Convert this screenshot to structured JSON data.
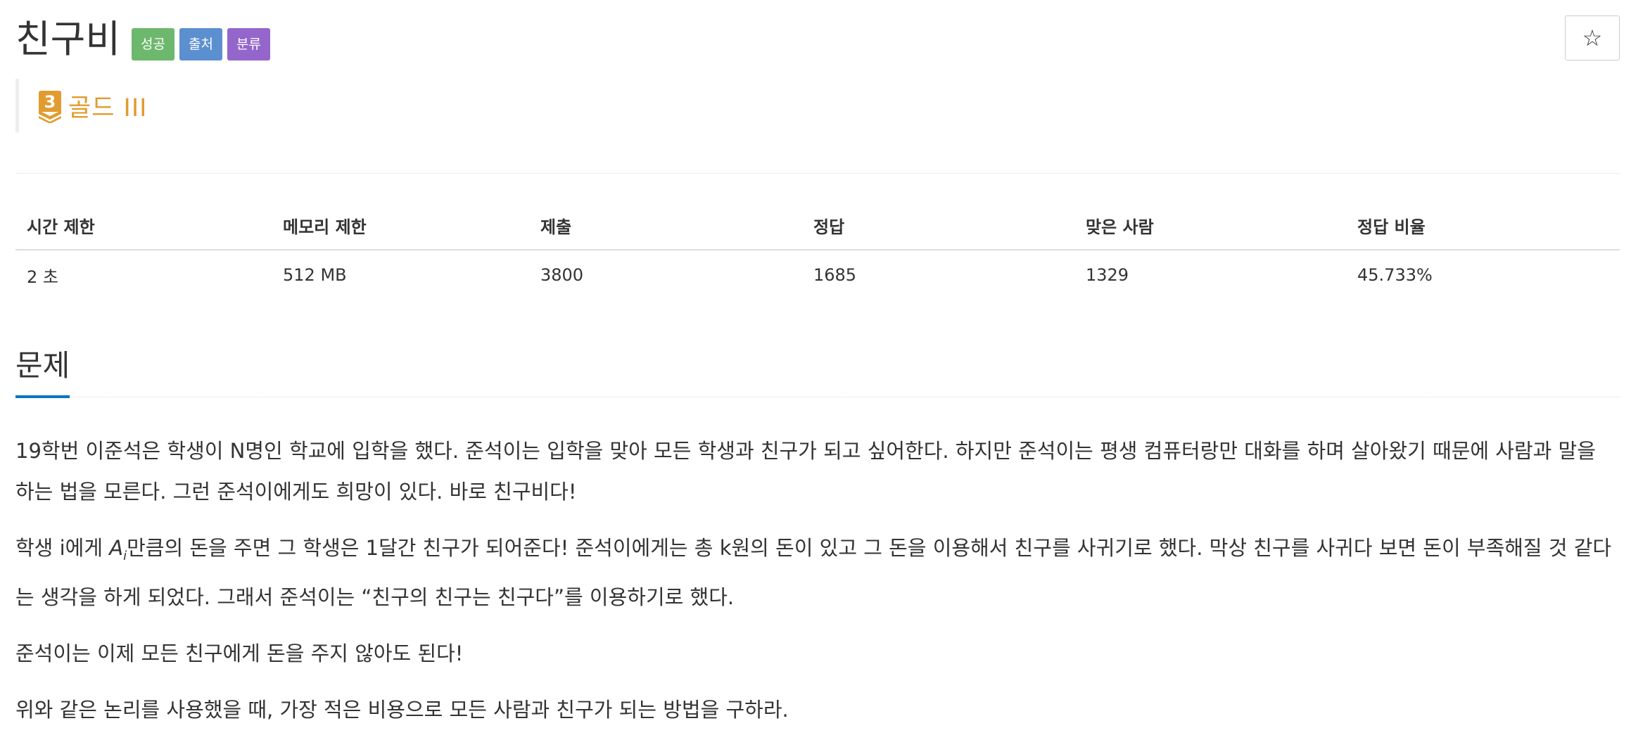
{
  "header": {
    "title": "친구비",
    "labels": {
      "success": "성공",
      "source": "출처",
      "category": "분류"
    },
    "star_icon": "☆",
    "tier": {
      "number": "3",
      "text": "골드 III",
      "color": "#e19b2f"
    }
  },
  "stats": {
    "headers": [
      "시간 제한",
      "메모리 제한",
      "제출",
      "정답",
      "맞은 사람",
      "정답 비율"
    ],
    "values": [
      "2 초",
      "512 MB",
      "3800",
      "1685",
      "1329",
      "45.733%"
    ]
  },
  "problem": {
    "section_title": "문제",
    "paragraph1": "19학번 이준석은 학생이 N명인 학교에 입학을 했다. 준석이는 입학을 맞아 모든 학생과 친구가 되고 싶어한다. 하지만 준석이는 평생 컴퓨터랑만 대화를 하며 살아왔기 때문에 사람과 말을 하는 법을 모른다. 그런 준석이에게도 희망이 있다. 바로 친구비다!",
    "paragraph2_prefix": "학생 i에게 ",
    "paragraph2_var": "A",
    "paragraph2_sub": "i",
    "paragraph2_suffix": "만큼의 돈을 주면 그 학생은 1달간 친구가 되어준다! 준석이에게는 총 k원의 돈이 있고 그 돈을 이용해서 친구를 사귀기로 했다. 막상 친구를 사귀다 보면 돈이 부족해질 것 같다는 생각을 하게 되었다. 그래서 준석이는 “친구의 친구는 친구다”를 이용하기로 했다.",
    "paragraph3": "준석이는 이제 모든 친구에게 돈을 주지 않아도 된다!",
    "paragraph4": "위와 같은 논리를 사용했을 때, 가장 적은 비용으로 모든 사람과 친구가 되는 방법을 구하라."
  },
  "colors": {
    "label_success": "#6db86d",
    "label_source": "#5b8fd0",
    "label_category": "#9466cc",
    "section_underline": "#0076c0"
  }
}
